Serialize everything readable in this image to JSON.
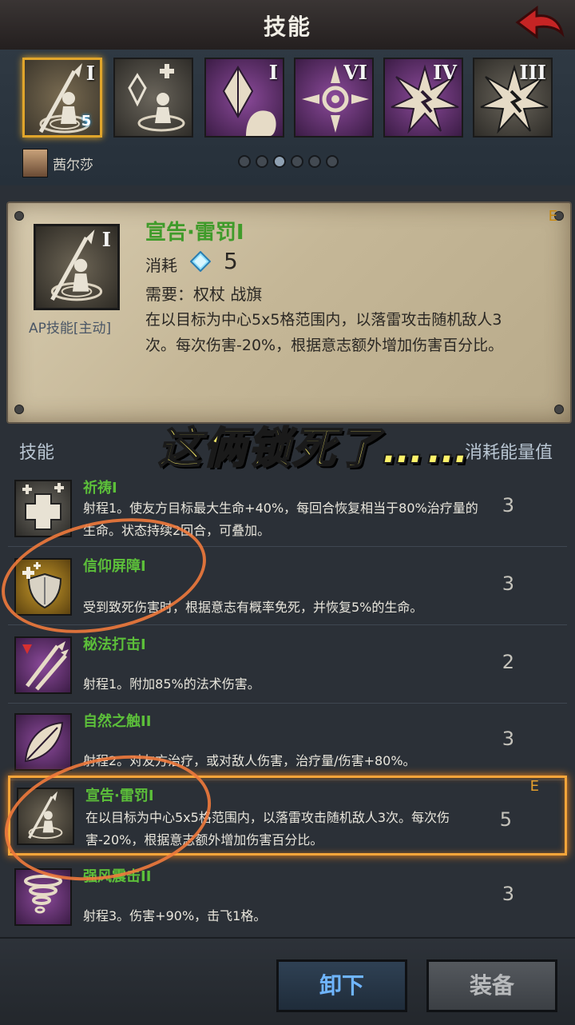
{
  "header": {
    "title": "技能"
  },
  "equipped_slots": [
    {
      "name": "宣告·雷罚",
      "rank": "I",
      "icon": "spear-altar-icon",
      "badge": "5",
      "selected": true,
      "theme": "gray"
    },
    {
      "name": "祈祷",
      "rank": "",
      "icon": "crystal-heal-icon",
      "badge": "",
      "selected": false,
      "theme": "gray"
    },
    {
      "name": "",
      "rank": "I",
      "icon": "crystal-hand-icon",
      "badge": "",
      "selected": false,
      "theme": "purple"
    },
    {
      "name": "",
      "rank": "VI",
      "icon": "cross-target-icon",
      "badge": "",
      "selected": false,
      "theme": "purple"
    },
    {
      "name": "",
      "rank": "IV",
      "icon": "burst-icon",
      "badge": "",
      "selected": false,
      "theme": "purple"
    },
    {
      "name": "",
      "rank": "III",
      "icon": "burst-icon",
      "badge": "",
      "selected": false,
      "theme": "gray"
    }
  ],
  "hero": {
    "name": "茜尔莎"
  },
  "pager": {
    "count": 6,
    "active": 2
  },
  "detail": {
    "name": "宣告·雷罚I",
    "rank_letter": "E",
    "icon_rank": "I",
    "type": "AP技能[主动]",
    "cost_label": "消耗",
    "cost_value": "5",
    "requirement": "需要：权杖 战旗",
    "description": "在以目标为中心5x5格范围内，以落雷攻击随机敌人3次。每次伤害-20%，根据意志额外增加伤害百分比。"
  },
  "overlay_caption": "这俩锁死了……",
  "list": {
    "header_left": "技能",
    "header_right": "消耗能量值",
    "items": [
      {
        "name": "祈祷I",
        "desc": "射程1。使友方目标最大生命+40%，每回合恢复相当于80%治疗量的生命。状态持续2回合，可叠加。",
        "cost": "3",
        "rank": "",
        "icon": "plus-cross-icon"
      },
      {
        "name": "信仰屏障I",
        "desc": "受到致死伤害时，根据意志有概率免死，并恢复5%的生命。",
        "cost": "3",
        "rank": "",
        "icon": "shield-icon"
      },
      {
        "name": "秘法打击I",
        "desc": "射程1。附加85%的法术伤害。",
        "cost": "2",
        "rank": "",
        "icon": "spears-icon"
      },
      {
        "name": "自然之触II",
        "desc": "射程2。对友方治疗，或对敌人伤害，治疗量/伤害+80%。",
        "cost": "3",
        "rank": "",
        "icon": "leaf-icon"
      },
      {
        "name": "宣告·雷罚I",
        "desc": "在以目标为中心5x5格范围内，以落雷攻击随机敌人3次。每次伤害-20%，根据意志额外增加伤害百分比。",
        "cost": "5",
        "rank": "E",
        "icon": "spear-altar-icon"
      },
      {
        "name": "强风震击II",
        "desc": "射程3。伤害+90%，击飞1格。",
        "cost": "3",
        "rank": "",
        "icon": "tornado-icon"
      }
    ]
  },
  "buttons": {
    "unequip": "卸下",
    "equip": "装备"
  },
  "colors": {
    "accent_orange": "#f5a53a",
    "skill_green": "#5cbf3a",
    "unequip_blue": "#6fb5ff",
    "annotation": "#f07a3c"
  }
}
